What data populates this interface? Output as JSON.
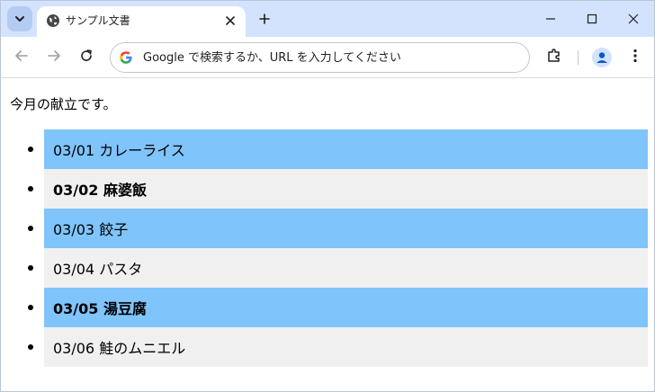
{
  "tab": {
    "title": "サンプル文書"
  },
  "omnibox": {
    "placeholder": "Google で検索するか、URL を入力してください"
  },
  "page": {
    "intro": "今月の献立です。",
    "menu": [
      {
        "text": "03/01 カレーライス",
        "bold": false
      },
      {
        "text": "03/02 麻婆飯",
        "bold": true
      },
      {
        "text": "03/03 餃子",
        "bold": false
      },
      {
        "text": "03/04 パスタ",
        "bold": false
      },
      {
        "text": "03/05 湯豆腐",
        "bold": true
      },
      {
        "text": "03/06 鮭のムニエル",
        "bold": false
      }
    ]
  },
  "colors": {
    "row_highlight": "#7fc4fa",
    "row_plain": "#f0f0f0",
    "tabstrip": "#d3e3fd"
  },
  "icons": [
    "tab-search-icon",
    "globe-icon",
    "close-icon",
    "plus-icon",
    "minimize-icon",
    "maximize-icon",
    "window-close-icon",
    "back-arrow-icon",
    "forward-arrow-icon",
    "reload-icon",
    "google-icon",
    "extensions-icon",
    "profile-icon",
    "more-icon"
  ]
}
